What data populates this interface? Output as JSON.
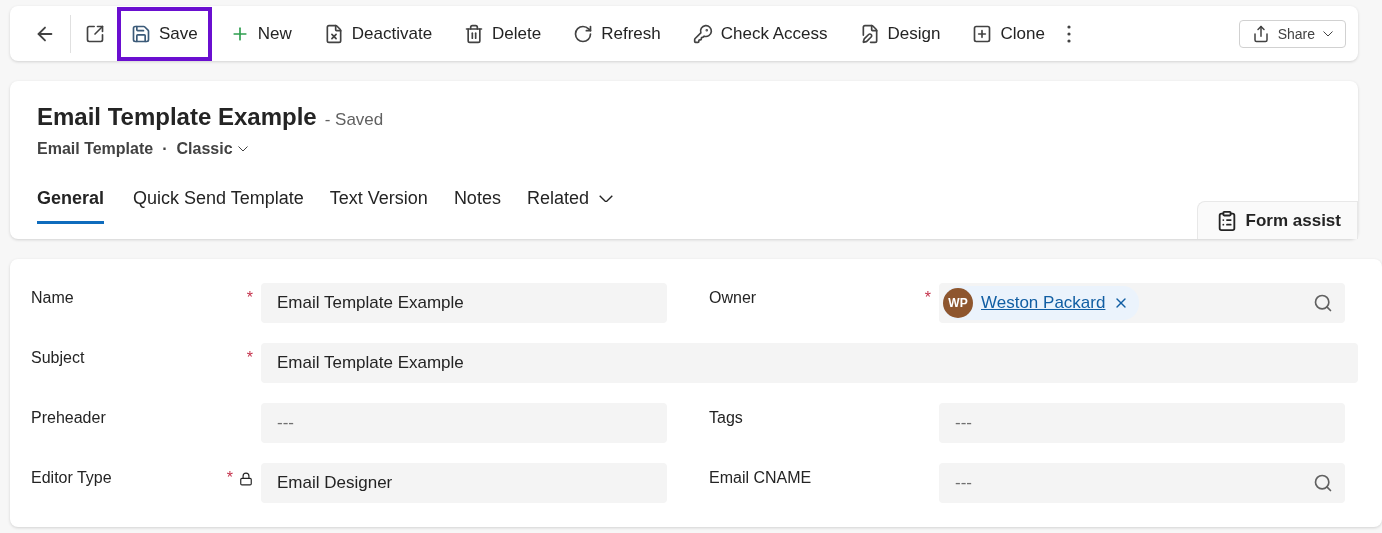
{
  "toolbar": {
    "buttons": [
      {
        "kind": "save",
        "label": "Save",
        "highlighted": true
      },
      {
        "kind": "new",
        "label": "New",
        "highlighted": false
      },
      {
        "kind": "deactivate",
        "label": "Deactivate",
        "highlighted": false
      },
      {
        "kind": "delete",
        "label": "Delete",
        "highlighted": false
      },
      {
        "kind": "refresh",
        "label": "Refresh",
        "highlighted": false
      },
      {
        "kind": "access",
        "label": "Check Access",
        "highlighted": false
      },
      {
        "kind": "design",
        "label": "Design",
        "highlighted": false
      },
      {
        "kind": "clone",
        "label": "Clone",
        "highlighted": false
      }
    ],
    "share": {
      "label": "Share"
    }
  },
  "header": {
    "title": "Email Template Example",
    "status": "- Saved",
    "entity": "Email Template",
    "separator": "·",
    "form_name": "Classic",
    "tabs": [
      {
        "label": "General",
        "selected": true,
        "dropdown": false
      },
      {
        "label": "Quick Send Template",
        "selected": false,
        "dropdown": false
      },
      {
        "label": "Text Version",
        "selected": false,
        "dropdown": false
      },
      {
        "label": "Notes",
        "selected": false,
        "dropdown": false
      },
      {
        "label": "Related",
        "selected": false,
        "dropdown": true
      }
    ],
    "form_assist": "Form assist"
  },
  "form": {
    "rows": [
      {
        "fields": [
          {
            "kind": "text",
            "label": "Name",
            "required_mark": "*",
            "value": "Email Template Example"
          },
          {
            "kind": "lookup",
            "label": "Owner",
            "required_mark": "*",
            "initials": "WP",
            "value": "Weston Packard"
          }
        ]
      },
      {
        "fields": [
          {
            "kind": "wide",
            "label": "Subject",
            "required_mark": "*",
            "value": "Email Template Example"
          }
        ]
      },
      {
        "fields": [
          {
            "kind": "text",
            "label": "Preheader",
            "placeholder": "---"
          },
          {
            "kind": "text",
            "label": "Tags",
            "placeholder": "---"
          }
        ]
      },
      {
        "fields": [
          {
            "kind": "text",
            "label": "Editor Type",
            "required_mark": "*",
            "locked": true,
            "value": "Email Designer"
          },
          {
            "kind": "search",
            "label": "Email CNAME",
            "placeholder": "---"
          }
        ]
      }
    ]
  }
}
